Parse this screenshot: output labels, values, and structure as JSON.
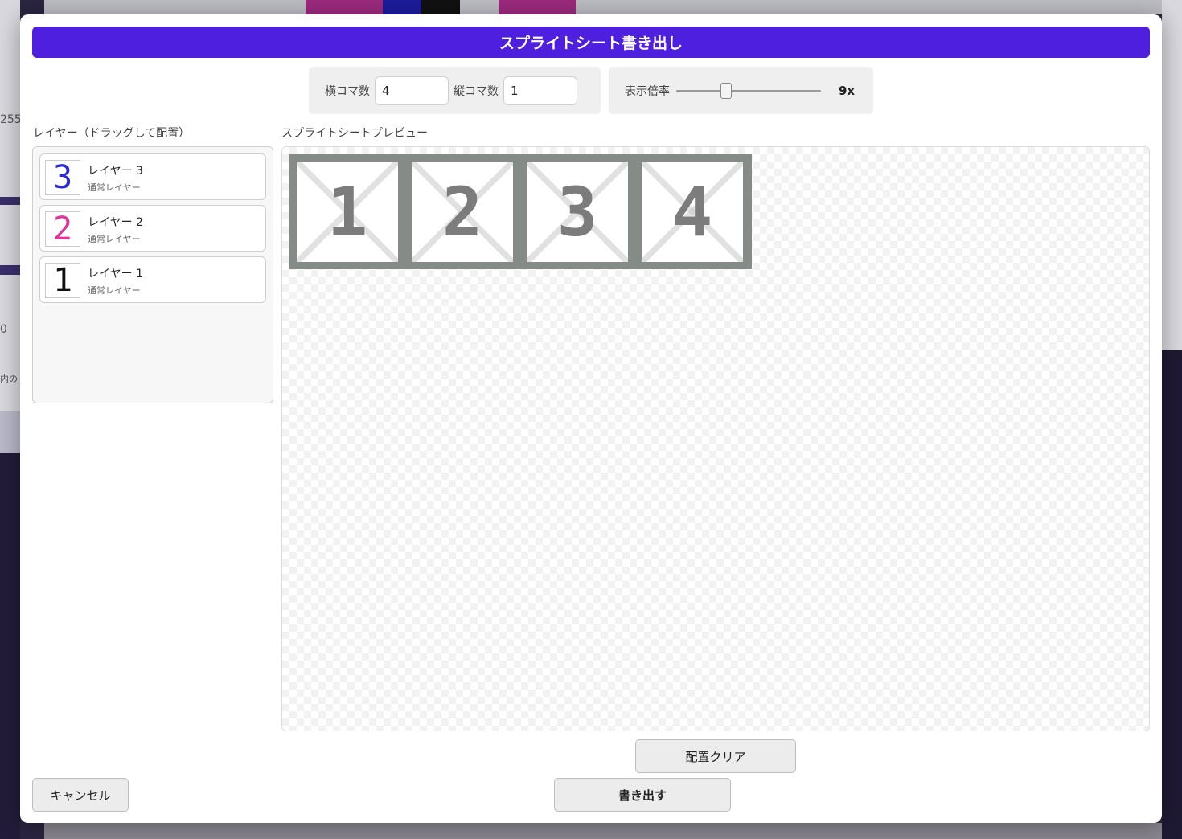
{
  "dialog": {
    "title": "スプライトシート書き出し"
  },
  "grid": {
    "cols_label": "横コマ数",
    "cols_value": "4",
    "rows_label": "縦コマ数",
    "rows_value": "1"
  },
  "zoom": {
    "label": "表示倍率",
    "value_text": "9x",
    "slider_fraction": 0.33
  },
  "layers": {
    "label": "レイヤー（ドラッグして配置）",
    "items": [
      {
        "name": "レイヤー 3",
        "type": "通常レイヤー",
        "glyph": "3",
        "color": "#2a2ad8"
      },
      {
        "name": "レイヤー 2",
        "type": "通常レイヤー",
        "glyph": "2",
        "color": "#e0359a"
      },
      {
        "name": "レイヤー 1",
        "type": "通常レイヤー",
        "glyph": "1",
        "color": "#111111"
      }
    ]
  },
  "preview": {
    "label": "スプライトシートプレビュー",
    "frames": [
      "1",
      "2",
      "3",
      "4"
    ]
  },
  "buttons": {
    "clear": "配置クリア",
    "export": "書き出す",
    "cancel": "キャンセル"
  },
  "colors": {
    "accent": "#4e1fde",
    "sheet_border": "#858b86"
  },
  "background": {
    "left_text_1": "255",
    "left_text_2": "0",
    "left_text_3": "内の"
  }
}
